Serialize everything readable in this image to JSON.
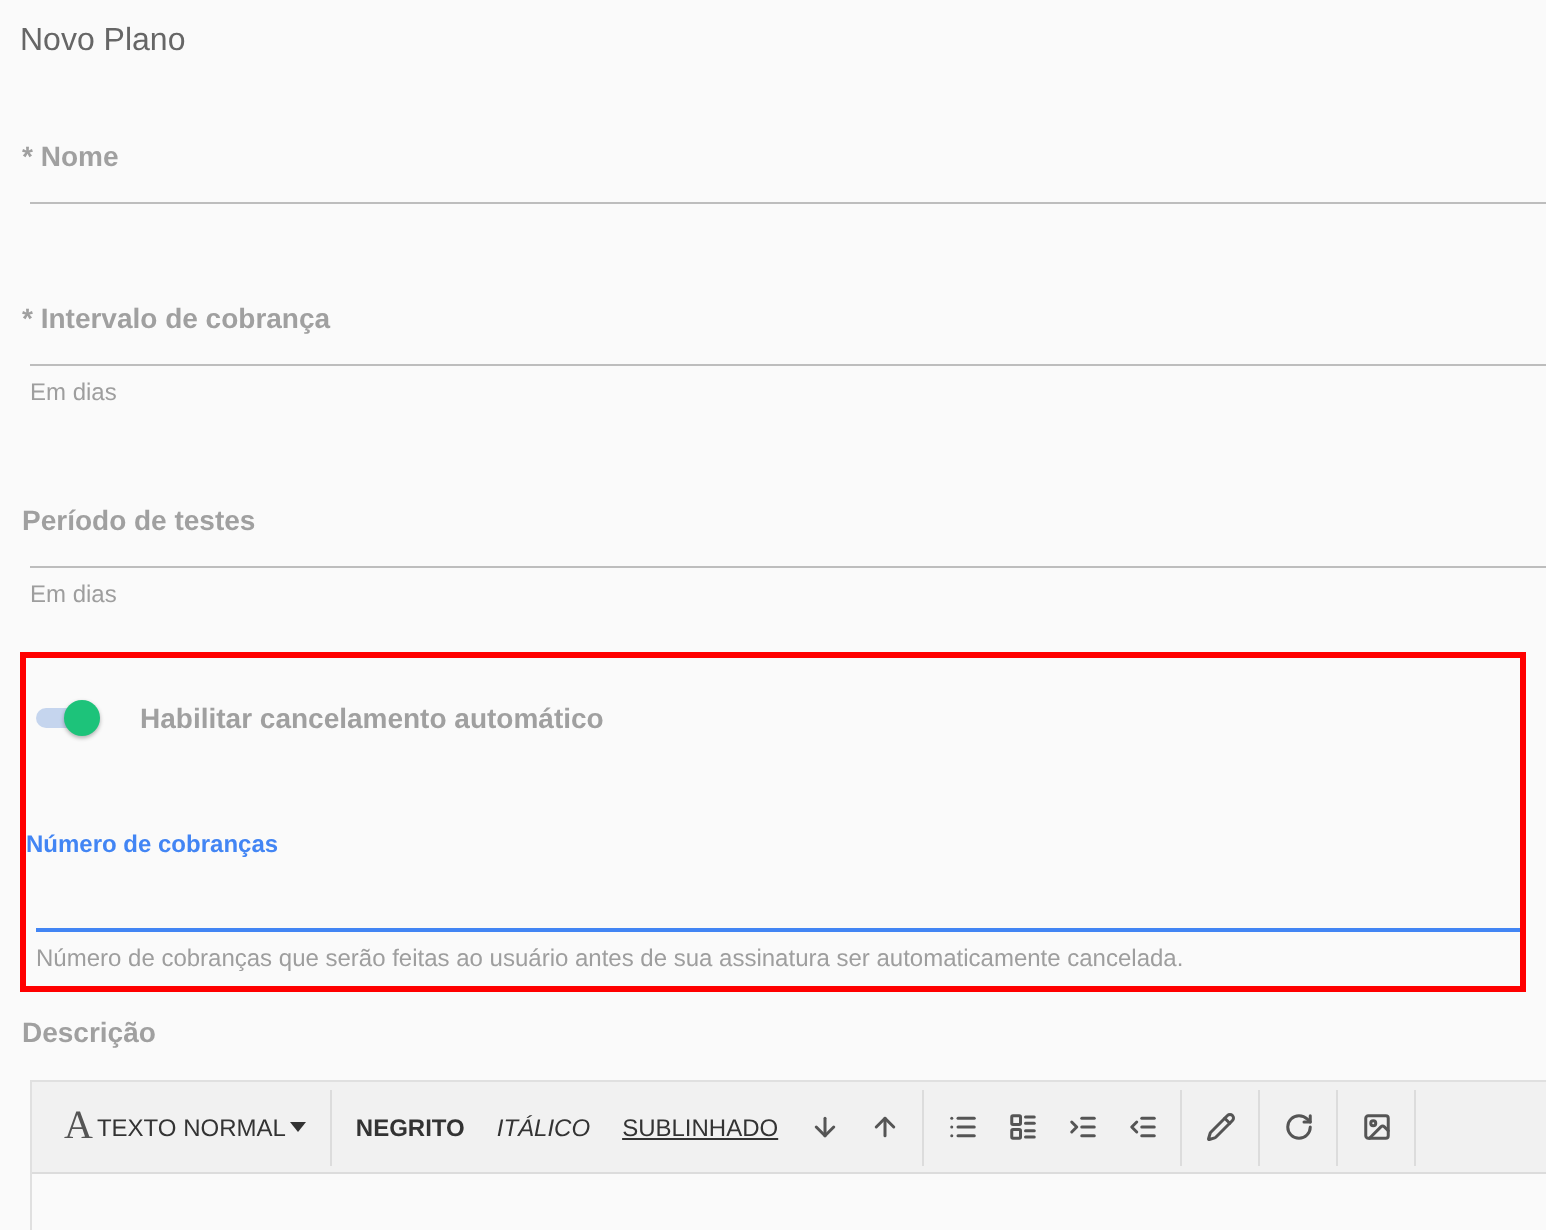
{
  "title": "Novo Plano",
  "fields": [
    {
      "kind": "text",
      "label": "* Nome",
      "focused": false
    },
    {
      "kind": "text",
      "label": "* Intervalo de cobrança",
      "hint": "Em dias",
      "focused": false
    },
    {
      "kind": "text",
      "label": "Período de testes",
      "hint": "Em dias",
      "focused": false
    }
  ],
  "highlighted_group": {
    "fields": [
      {
        "kind": "toggle",
        "label": "Habilitar cancelamento automático",
        "on": true
      },
      {
        "kind": "text",
        "label": "Número de cobranças",
        "hint": "Número de cobranças que serão feitas ao usuário antes de sua assinatura ser automaticamente cancelada.",
        "focused": true
      }
    ]
  },
  "description": {
    "label": "Descrição",
    "toolbar": [
      {
        "kind": "dropdown",
        "icon": "A",
        "label": "TEXTO NORMAL"
      },
      {
        "kind": "separator"
      },
      {
        "kind": "format",
        "label": "NEGRITO"
      },
      {
        "kind": "format",
        "label": "ITÁLICO"
      },
      {
        "kind": "format",
        "label": "SUBLINHADO"
      },
      {
        "kind": "icon-button"
      },
      {
        "kind": "icon-button"
      },
      {
        "kind": "separator"
      },
      {
        "kind": "icon-button"
      },
      {
        "kind": "icon-button"
      },
      {
        "kind": "icon-button"
      },
      {
        "kind": "icon-button"
      },
      {
        "kind": "separator"
      },
      {
        "kind": "icon-button"
      },
      {
        "kind": "separator"
      },
      {
        "kind": "icon-button"
      },
      {
        "kind": "separator"
      },
      {
        "kind": "icon-button"
      },
      {
        "kind": "separator"
      }
    ]
  }
}
